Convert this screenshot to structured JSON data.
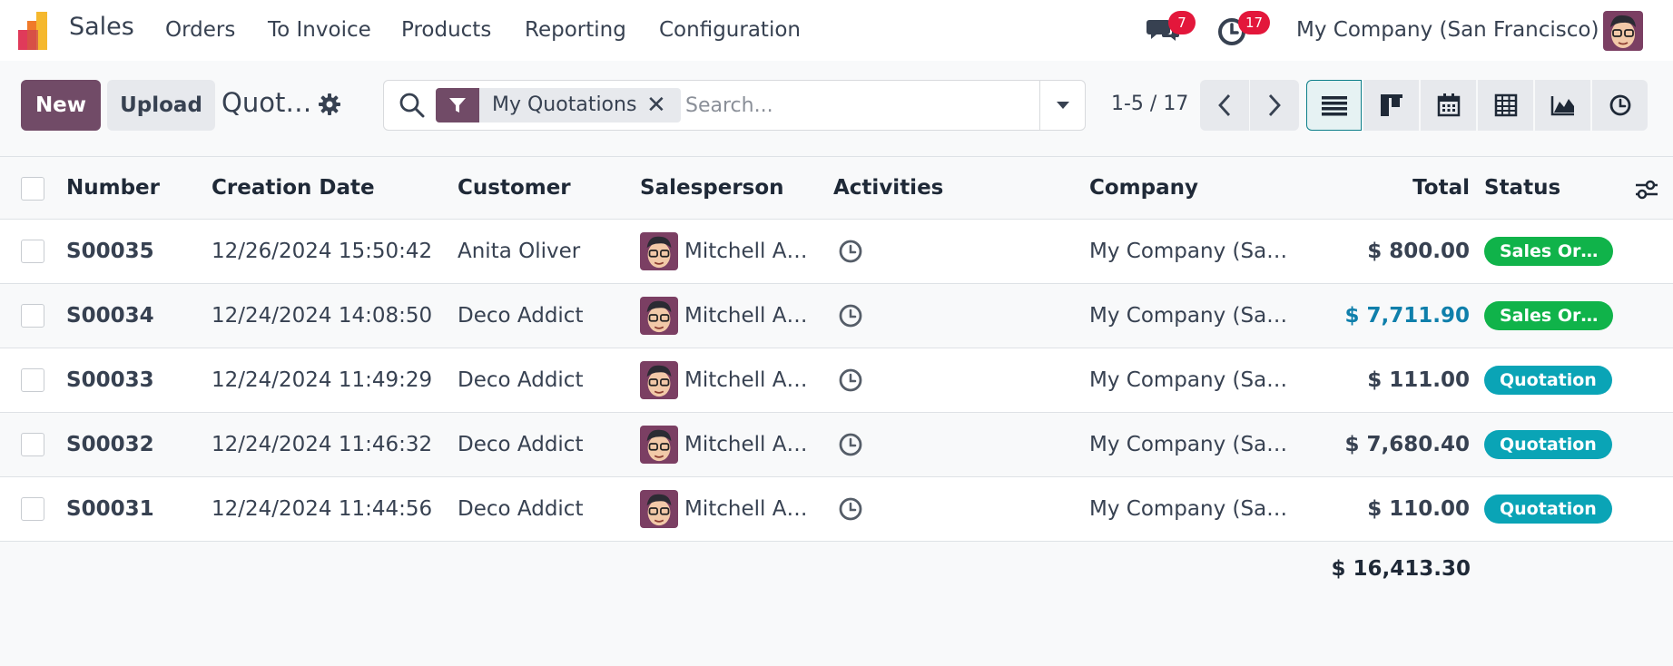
{
  "app": {
    "name": "Sales"
  },
  "menu": [
    "Orders",
    "To Invoice",
    "Products",
    "Reporting",
    "Configuration"
  ],
  "systray": {
    "messages_count": "7",
    "activities_count": "17",
    "company": "My Company (San Francisco)"
  },
  "toolbar": {
    "new_label": "New",
    "upload_label": "Upload",
    "breadcrumb": "Quot…"
  },
  "search": {
    "facet": "My Quotations",
    "placeholder": "Search..."
  },
  "pager": {
    "value": "1-5 / 17"
  },
  "views": [
    "list-view-icon",
    "kanban-view-icon",
    "calendar-view-icon",
    "pivot-view-icon",
    "graph-view-icon",
    "activity-view-icon"
  ],
  "colors": {
    "brand": "#714b67",
    "sales_order": "#10b34a",
    "quotation": "#0aa4b6",
    "highlight_total": "#0f7fab",
    "badge": "#e3173b"
  },
  "table": {
    "headers": {
      "number": "Number",
      "date": "Creation Date",
      "customer": "Customer",
      "salesperson": "Salesperson",
      "activities": "Activities",
      "company": "Company",
      "total": "Total",
      "status": "Status"
    },
    "rows": [
      {
        "number": "S00035",
        "date": "12/26/2024 15:50:42",
        "customer": "Anita Oliver",
        "salesperson": "Mitchell A…",
        "company": "My Company (Sa…",
        "total": "$ 800.00",
        "status": "Sales Or…",
        "status_type": "sales"
      },
      {
        "number": "S00034",
        "date": "12/24/2024 14:08:50",
        "customer": "Deco Addict",
        "salesperson": "Mitchell A…",
        "company": "My Company (Sa…",
        "total": "$ 7,711.90",
        "status": "Sales Or…",
        "status_type": "sales"
      },
      {
        "number": "S00033",
        "date": "12/24/2024 11:49:29",
        "customer": "Deco Addict",
        "salesperson": "Mitchell A…",
        "company": "My Company (Sa…",
        "total": "$ 111.00",
        "status": "Quotation",
        "status_type": "quote"
      },
      {
        "number": "S00032",
        "date": "12/24/2024 11:46:32",
        "customer": "Deco Addict",
        "salesperson": "Mitchell A…",
        "company": "My Company (Sa…",
        "total": "$ 7,680.40",
        "status": "Quotation",
        "status_type": "quote"
      },
      {
        "number": "S00031",
        "date": "12/24/2024 11:44:56",
        "customer": "Deco Addict",
        "salesperson": "Mitchell A…",
        "company": "My Company (Sa…",
        "total": "$ 110.00",
        "status": "Quotation",
        "status_type": "quote"
      }
    ],
    "grand_total": "$ 16,413.30"
  }
}
